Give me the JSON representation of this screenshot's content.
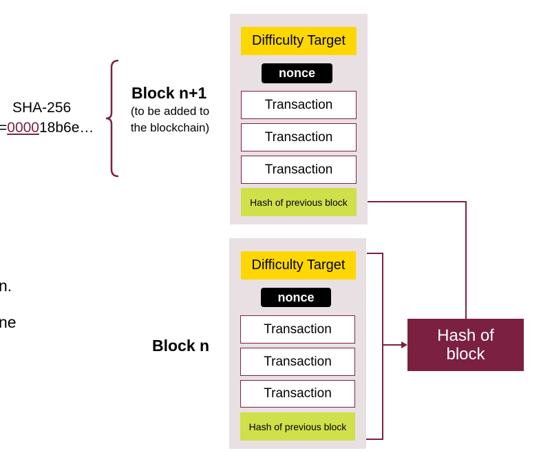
{
  "left_text": {
    "hash_label": "SHA-256",
    "hash_prefix": "=",
    "hash_zeros": "0000",
    "hash_rest": "18b6e…",
    "fragment_1": "n.",
    "fragment_2": "ne"
  },
  "block_n1": {
    "title": "Block n+1",
    "subtitle_1": "(to be added to",
    "subtitle_2": "the blockchain)",
    "difficulty": "Difficulty Target",
    "nonce": "nonce",
    "transactions": [
      "Transaction",
      "Transaction",
      "Transaction"
    ],
    "prev_hash": "Hash of previous block"
  },
  "block_n": {
    "title": "Block n",
    "difficulty": "Difficulty Target",
    "nonce": "nonce",
    "transactions": [
      "Transaction",
      "Transaction",
      "Transaction"
    ],
    "prev_hash": "Hash of previous block"
  },
  "hash_box": {
    "line1": "Hash of",
    "line2": "block"
  },
  "colors": {
    "accent": "#7b2040",
    "difficulty": "#ffd700",
    "prev_hash": "#cfe04a",
    "panel": "#e9e0e3"
  }
}
